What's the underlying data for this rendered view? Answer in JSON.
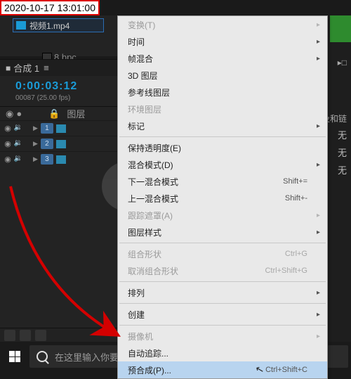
{
  "timestamp": "2020-10-17 13:01:00",
  "project": {
    "file": "视频1.mp4",
    "bpc": "8 bpc"
  },
  "timeline": {
    "tab": "合成 1",
    "timecode": "0:00:03:12",
    "frame_info": "00087 (25.00 fps)",
    "header": {
      "source_col": "图层",
      "lock": "🔒"
    },
    "layers": [
      {
        "num": "1"
      },
      {
        "num": "2"
      },
      {
        "num": "3"
      }
    ]
  },
  "right": {
    "label1": "▸□",
    "label2": "及和链",
    "none": "无"
  },
  "menu": {
    "items": [
      {
        "label": "变换(T)",
        "sub": true,
        "dis": true
      },
      {
        "label": "时间",
        "sub": true
      },
      {
        "label": "帧混合",
        "sub": true
      },
      {
        "label": "3D 图层"
      },
      {
        "label": "参考线图层"
      },
      {
        "label": "环境图层",
        "dis": true
      },
      {
        "label": "标记",
        "sub": true
      },
      {
        "sep": true
      },
      {
        "label": "保持透明度(E)"
      },
      {
        "label": "混合模式(D)",
        "sub": true
      },
      {
        "label": "下一混合模式",
        "shortcut": "Shift+="
      },
      {
        "label": "上一混合模式",
        "shortcut": "Shift+-"
      },
      {
        "label": "跟踪遮罩(A)",
        "sub": true,
        "dis": true
      },
      {
        "label": "图层样式",
        "sub": true
      },
      {
        "sep": true
      },
      {
        "label": "组合形状",
        "shortcut": "Ctrl+G",
        "dis": true
      },
      {
        "label": "取消组合形状",
        "shortcut": "Ctrl+Shift+G",
        "dis": true
      },
      {
        "sep": true
      },
      {
        "label": "排列",
        "sub": true
      },
      {
        "sep": true
      },
      {
        "label": "创建",
        "sub": true
      },
      {
        "sep": true
      },
      {
        "label": "摄像机",
        "sub": true,
        "dis": true
      },
      {
        "label": "自动追踪..."
      },
      {
        "label": "预合成(P)...",
        "shortcut": "Ctrl+Shift+C",
        "hl": true
      }
    ]
  },
  "taskbar": {
    "search_placeholder": "在这里输入你要搜索的内容"
  }
}
